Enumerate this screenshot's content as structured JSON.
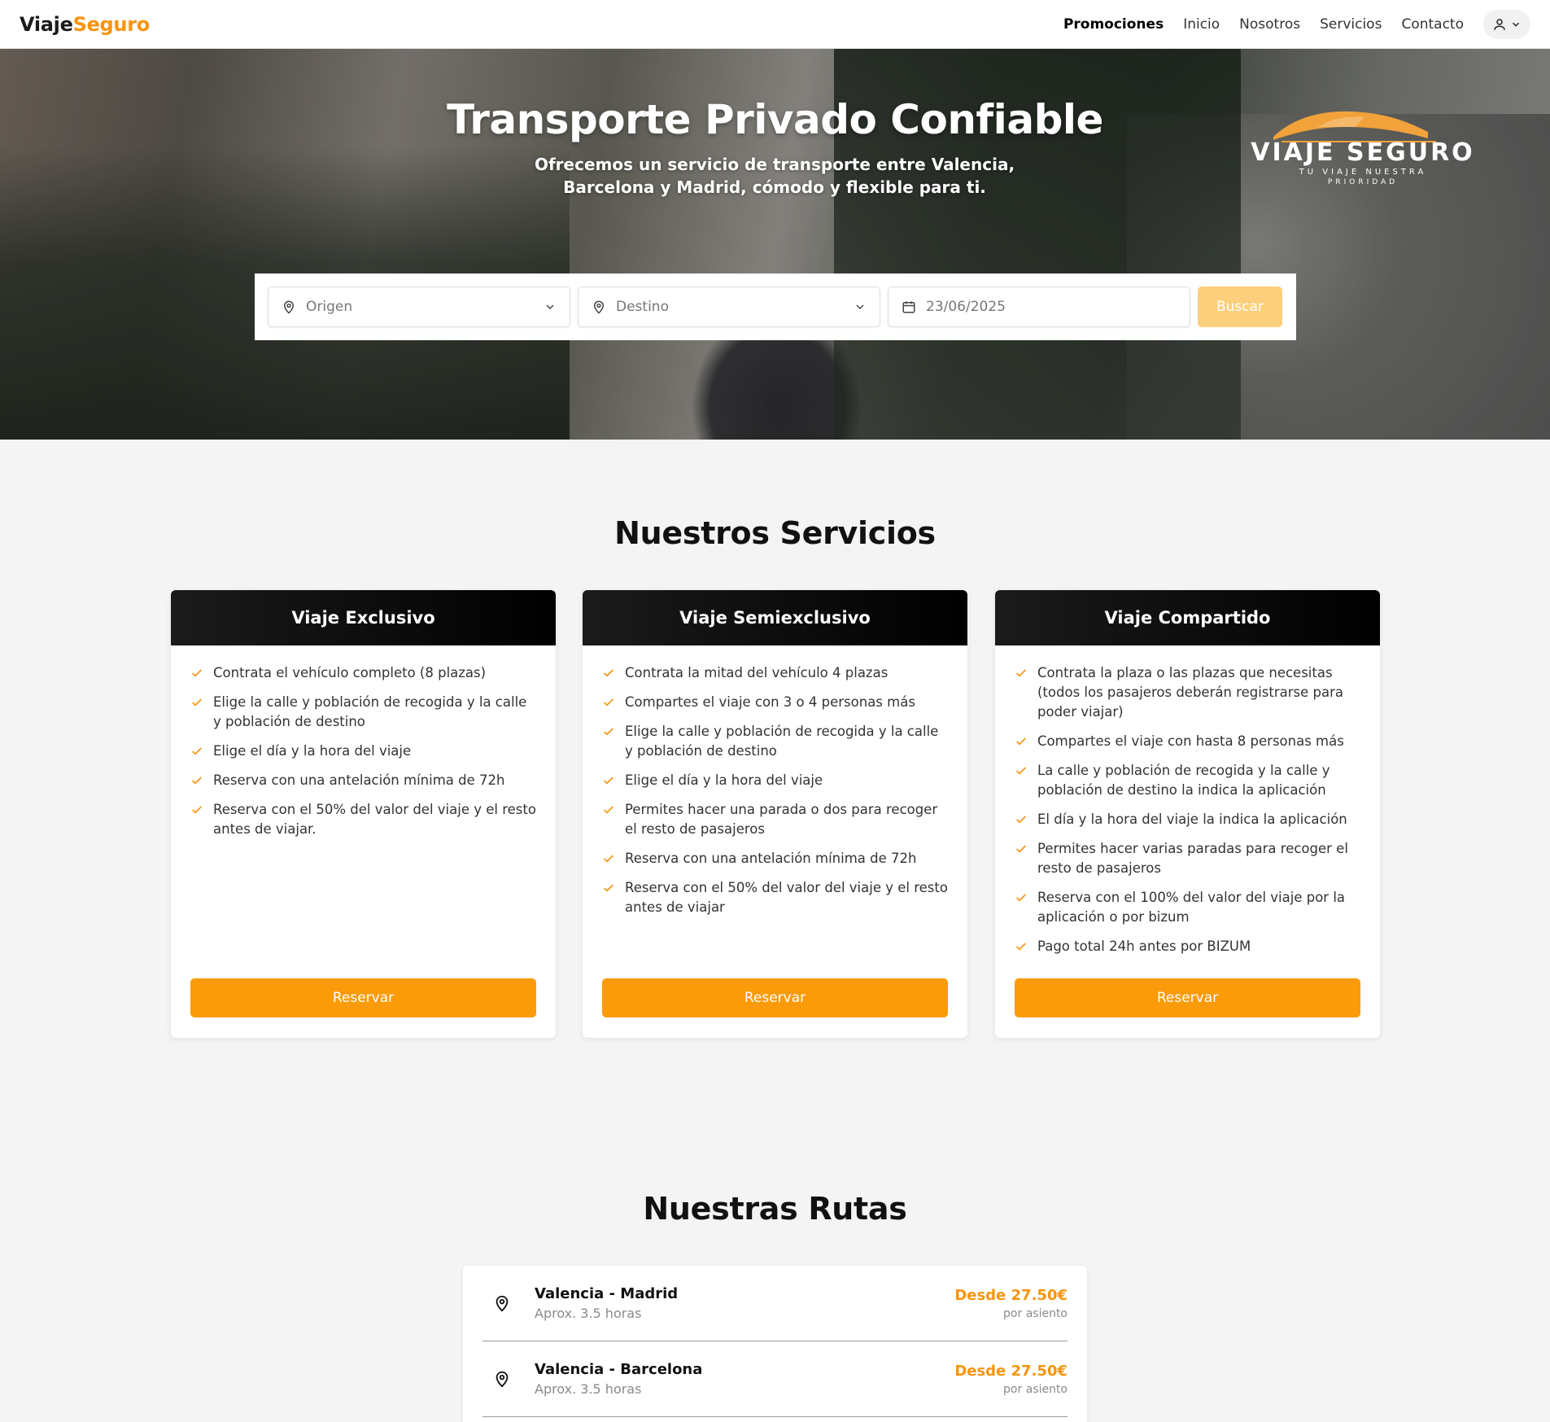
{
  "nav": {
    "brand_part1": "Viaje",
    "brand_part2": "Seguro",
    "links": [
      "Promociones",
      "Inicio",
      "Nosotros",
      "Servicios",
      "Contacto"
    ],
    "user_icon": "user-icon"
  },
  "hero": {
    "title": "Transporte Privado Confiable",
    "subtitle": "Ofrecemos un servicio de transporte entre Valencia, Barcelona y Madrid, cómodo y flexible para ti.",
    "logo_main": "VIAJE SEGURO",
    "logo_tag1": "TU VIAJE NUESTRA",
    "logo_tag2": "PRIORIDAD"
  },
  "search": {
    "origen_placeholder": "Origen",
    "destino_placeholder": "Destino",
    "date_value": "23/06/2025",
    "button_label": "Buscar"
  },
  "services": {
    "title": "Nuestros Servicios",
    "cards": [
      {
        "title": "Viaje Exclusivo",
        "items": [
          "Contrata el vehículo completo (8 plazas)",
          "Elige la calle y población de recogida y la calle y población de destino",
          "Elige el día y la hora del viaje",
          "Reserva con una antelación mínima de 72h",
          "Reserva con el 50% del valor del viaje y el resto antes de viajar."
        ],
        "button": "Reservar"
      },
      {
        "title": "Viaje Semiexclusivo",
        "items": [
          "Contrata la mitad del vehículo 4 plazas",
          "Compartes el viaje con 3 o 4 personas más",
          "Elige la calle y población de recogida y la calle y población de destino",
          "Elige el día y la hora del viaje",
          "Permites hacer una parada o dos para recoger el resto de pasajeros",
          "Reserva con una antelación mínima de 72h",
          "Reserva con el 50% del valor del viaje y el resto antes de viajar"
        ],
        "button": "Reservar"
      },
      {
        "title": "Viaje Compartido",
        "items": [
          "Contrata la plaza o las plazas que necesitas (todos los pasajeros deberán registrarse para poder viajar)",
          "Compartes el viaje con hasta 8 personas más",
          "La calle y población de recogida y la calle y población de destino la indica la aplicación",
          "El día y la hora del viaje la indica la aplicación",
          "Permites hacer varias paradas para recoger el resto de pasajeros",
          "Reserva con el 100% del valor del viaje por la aplicación o por bizum",
          "Pago total 24h antes por BIZUM"
        ],
        "button": "Reservar"
      }
    ]
  },
  "routes": {
    "title": "Nuestras Rutas",
    "items": [
      {
        "name": "Valencia - Madrid",
        "duration": "Aprox. 3.5 horas",
        "price": "Desde 27.50€",
        "unit": "por asiento"
      },
      {
        "name": "Valencia - Barcelona",
        "duration": "Aprox. 3.5 horas",
        "price": "Desde 27.50€",
        "unit": "por asiento"
      }
    ]
  },
  "colors": {
    "accent": "#f7940f",
    "button": "#fb9b0a",
    "button_disabled": "#fccf7d",
    "card_header": "#000000"
  }
}
